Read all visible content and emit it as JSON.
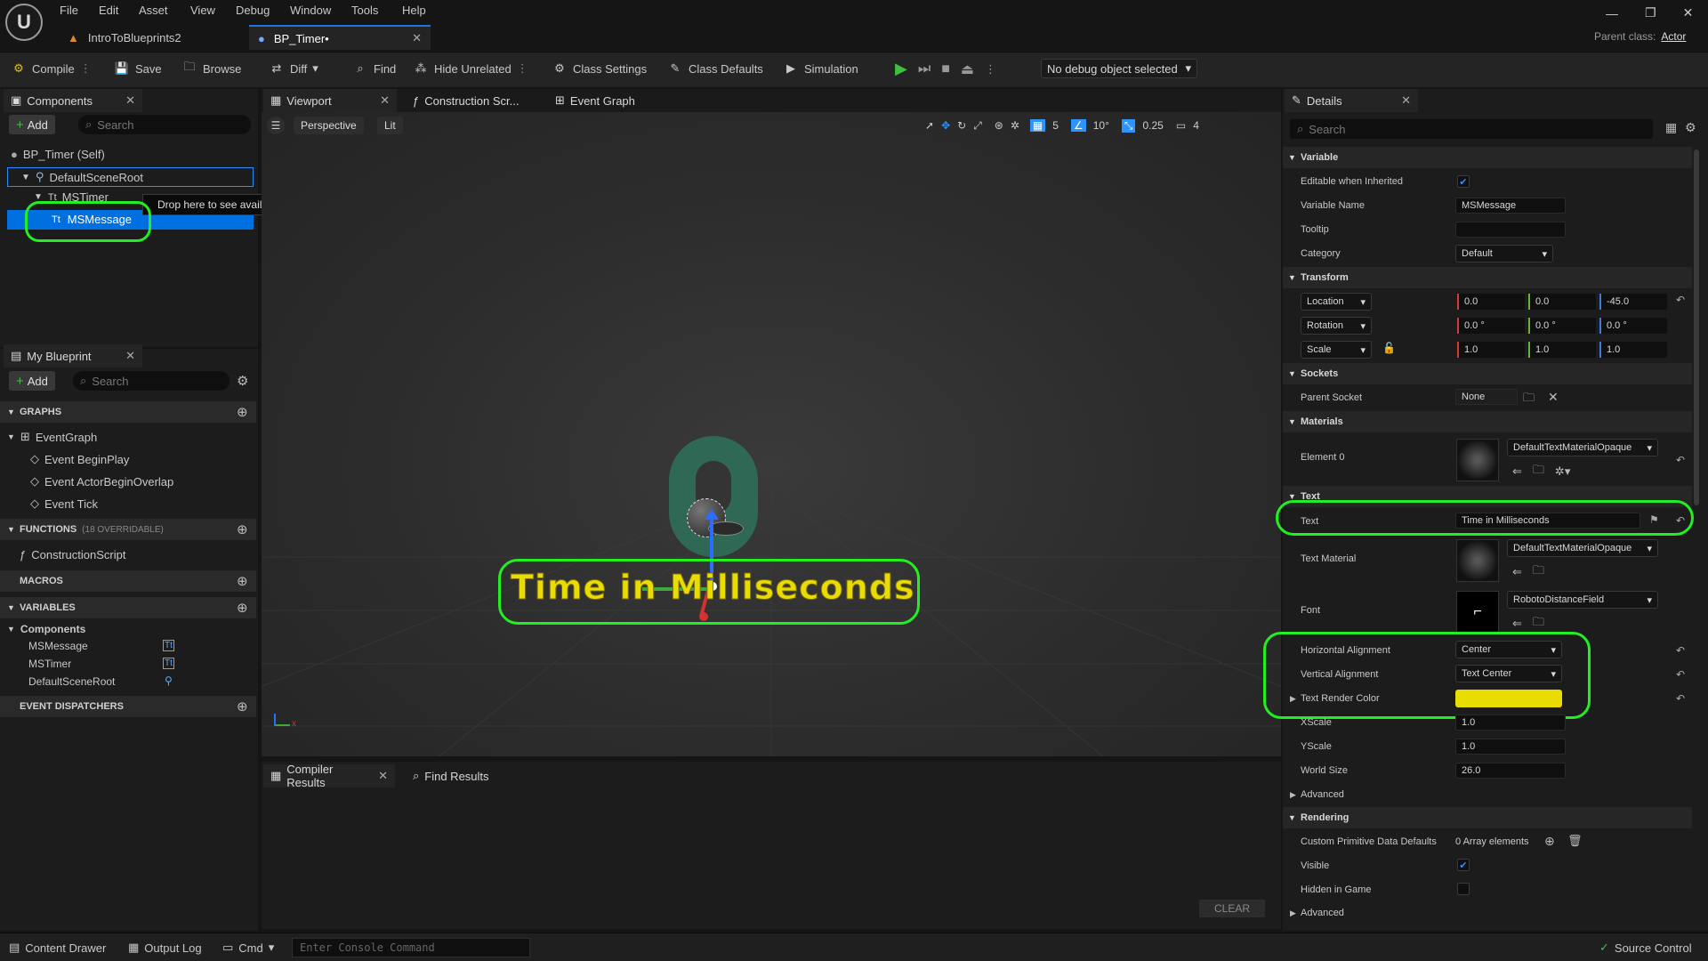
{
  "menu": {
    "items": [
      "File",
      "Edit",
      "Asset",
      "View",
      "Debug",
      "Window",
      "Tools",
      "Help"
    ]
  },
  "window": {
    "parent_class_label": "Parent class:",
    "parent_class_value": "Actor"
  },
  "tabs": [
    {
      "label": "IntroToBlueprints2"
    },
    {
      "label": "BP_Timer•"
    }
  ],
  "toolbar": {
    "compile": "Compile",
    "save": "Save",
    "browse": "Browse",
    "diff": "Diff",
    "find": "Find",
    "hide_unrelated": "Hide Unrelated",
    "class_settings": "Class Settings",
    "class_defaults": "Class Defaults",
    "simulation": "Simulation",
    "debug_object": "No debug object selected"
  },
  "components": {
    "tab": "Components",
    "add": "Add",
    "search_placeholder": "Search",
    "tree": [
      "BP_Timer (Self)",
      "DefaultSceneRoot",
      "MSTimer",
      "MSMessage"
    ],
    "tooltip": "Drop here to see available actions."
  },
  "my_blueprint": {
    "tab": "My Blueprint",
    "add": "Add",
    "search_placeholder": "Search",
    "graphs_header": "GRAPHS",
    "event_graph": "EventGraph",
    "events": [
      "Event BeginPlay",
      "Event ActorBeginOverlap",
      "Event Tick"
    ],
    "functions_header": "FUNCTIONS",
    "functions_note": "(18 OVERRIDABLE)",
    "construction_script": "ConstructionScript",
    "macros_header": "MACROS",
    "variables_header": "VARIABLES",
    "variables_group": "Components",
    "variables": [
      "MSMessage",
      "MSTimer",
      "DefaultSceneRoot"
    ],
    "dispatchers_header": "EVENT DISPATCHERS"
  },
  "center_tabs": {
    "viewport": "Viewport",
    "construction": "Construction Scr...",
    "event_graph": "Event Graph"
  },
  "viewport": {
    "perspective": "Perspective",
    "lit": "Lit",
    "grid_value": "5",
    "angle_value": "10°",
    "scale_value": "0.25",
    "camera_value": "4",
    "digit": "0",
    "text_render": "Time in Milliseconds"
  },
  "bottom_tabs": {
    "compiler_results": "Compiler Results",
    "find_results": "Find Results",
    "clear": "CLEAR"
  },
  "details": {
    "tab": "Details",
    "search_placeholder": "Search",
    "variable_header": "Variable",
    "editable_label": "Editable when Inherited",
    "var_name_label": "Variable Name",
    "var_name_value": "MSMessage",
    "tooltip_label": "Tooltip",
    "tooltip_value": "",
    "category_label": "Category",
    "category_value": "Default",
    "transform_header": "Transform",
    "location_label": "Location",
    "location": [
      "0.0",
      "0.0",
      "-45.0"
    ],
    "rotation_label": "Rotation",
    "rotation": [
      "0.0 °",
      "0.0 °",
      "0.0 °"
    ],
    "scale_label": "Scale",
    "scale": [
      "1.0",
      "1.0",
      "1.0"
    ],
    "sockets_header": "Sockets",
    "parent_socket_label": "Parent Socket",
    "parent_socket_value": "None",
    "materials_header": "Materials",
    "element0_label": "Element 0",
    "element0_value": "DefaultTextMaterialOpaque",
    "text_header": "Text",
    "text_label": "Text",
    "text_value": "Time in Milliseconds",
    "text_material_label": "Text Material",
    "text_material_value": "DefaultTextMaterialOpaque",
    "font_label": "Font",
    "font_value": "RobotoDistanceField",
    "halign_label": "Horizontal Alignment",
    "halign_value": "Center",
    "valign_label": "Vertical Alignment",
    "valign_value": "Text Center",
    "render_color_label": "Text Render Color",
    "render_color": "#e8dc00",
    "xscale_label": "XScale",
    "xscale_value": "1.0",
    "yscale_label": "YScale",
    "yscale_value": "1.0",
    "world_size_label": "World Size",
    "world_size_value": "26.0",
    "advanced": "Advanced",
    "rendering_header": "Rendering",
    "custom_primitive_label": "Custom Primitive Data Defaults",
    "custom_primitive_value": "0 Array elements",
    "visible_label": "Visible",
    "hidden_label": "Hidden in Game",
    "advanced2": "Advanced"
  },
  "statusbar": {
    "content_drawer": "Content Drawer",
    "output_log": "Output Log",
    "cmd": "Cmd",
    "console_placeholder": "Enter Console Command",
    "source_control": "Source Control"
  },
  "colors": {
    "accent": "#1c78d8",
    "highlight": "#22ee22",
    "selected": "#0070e0"
  }
}
